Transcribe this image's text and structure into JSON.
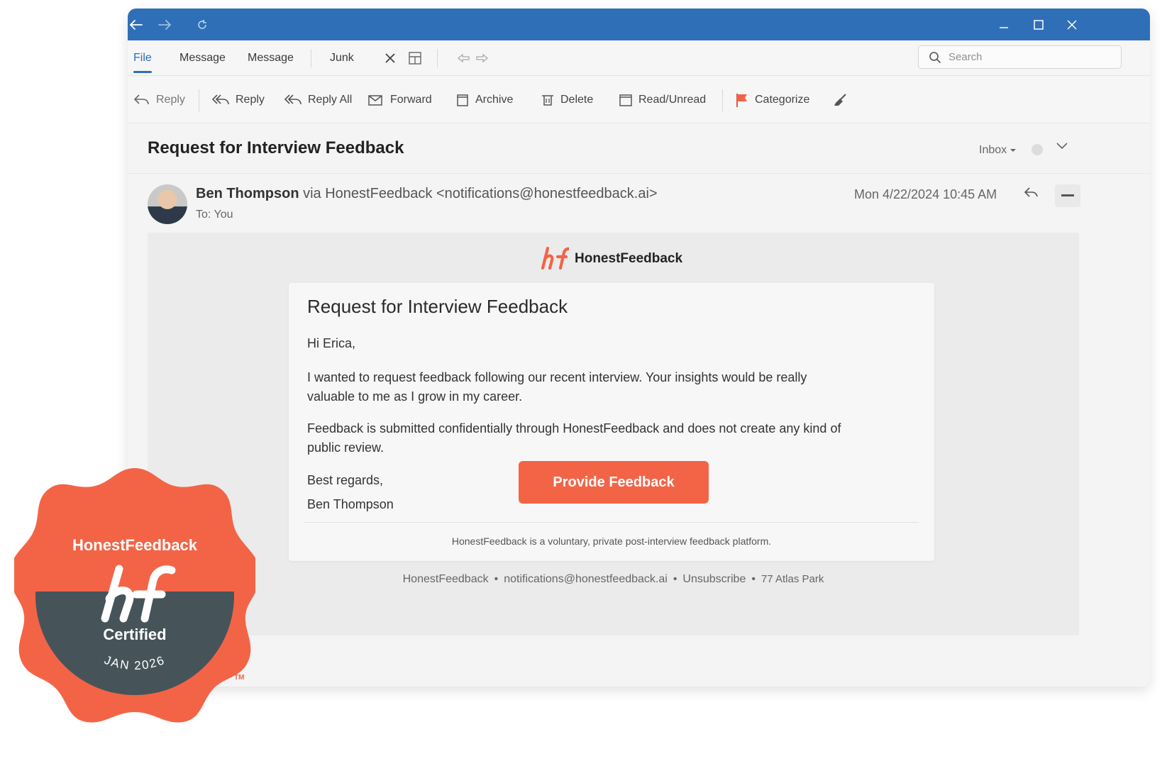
{
  "window": {
    "title_controls": [
      "back-arrow",
      "forward-arrow",
      "refresh-icon",
      "minimize-icon",
      "maximize-icon",
      "close-icon"
    ],
    "accent": "#2f6fb8"
  },
  "ribbon": {
    "tabs": [
      "File",
      "Message",
      "Message",
      "Junk"
    ],
    "search_placeholder": "Search"
  },
  "toolbar": {
    "reply1": "Reply",
    "reply2": "Reply",
    "reply_all": "Reply All",
    "forward": "Forward",
    "archive": "Archive",
    "delete": "Delete",
    "read_unread": "Read/Unread",
    "categorize": "Categorize"
  },
  "message": {
    "subject": "Request for Interview Feedback",
    "folder": "Inbox",
    "sender_name": "Ben Thompson",
    "sender_via": " via HonestFeedback <notifications@honestfeedback.ai>",
    "to": "To: You",
    "date": "Mon 4/22/2024 10:45 AM"
  },
  "email_body": {
    "brand": "HonestFeedback",
    "title": "Request for Interview Feedback",
    "greeting": "Hi Erica,",
    "para1_line1": "I wanted to request feedback following our recent interview. Your insights would be really",
    "para1_line2": "valuable to me as I grow in my career.",
    "para2_line1": "Feedback is submitted confidentially through HonestFeedback and does not create any kind of",
    "para2_line2": "public review.",
    "closing": "Best regards,",
    "signature": "Ben Thompson",
    "cta": "Provide Feedback",
    "disclaimer": "HonestFeedback is a voluntary, private post-interview feedback platform.",
    "footer": {
      "brand": "HonestFeedback",
      "email": "notifications@honestfeedback.ai",
      "unsubscribe": "Unsubscribe",
      "address": "77 Atlas Park"
    },
    "brand_color": "#f36447"
  },
  "badge": {
    "title": "HonestFeedback",
    "certified": "Certified",
    "date": "JAN 2026",
    "tm": "TM",
    "fill": "#f36447",
    "inner": "#46545a"
  }
}
